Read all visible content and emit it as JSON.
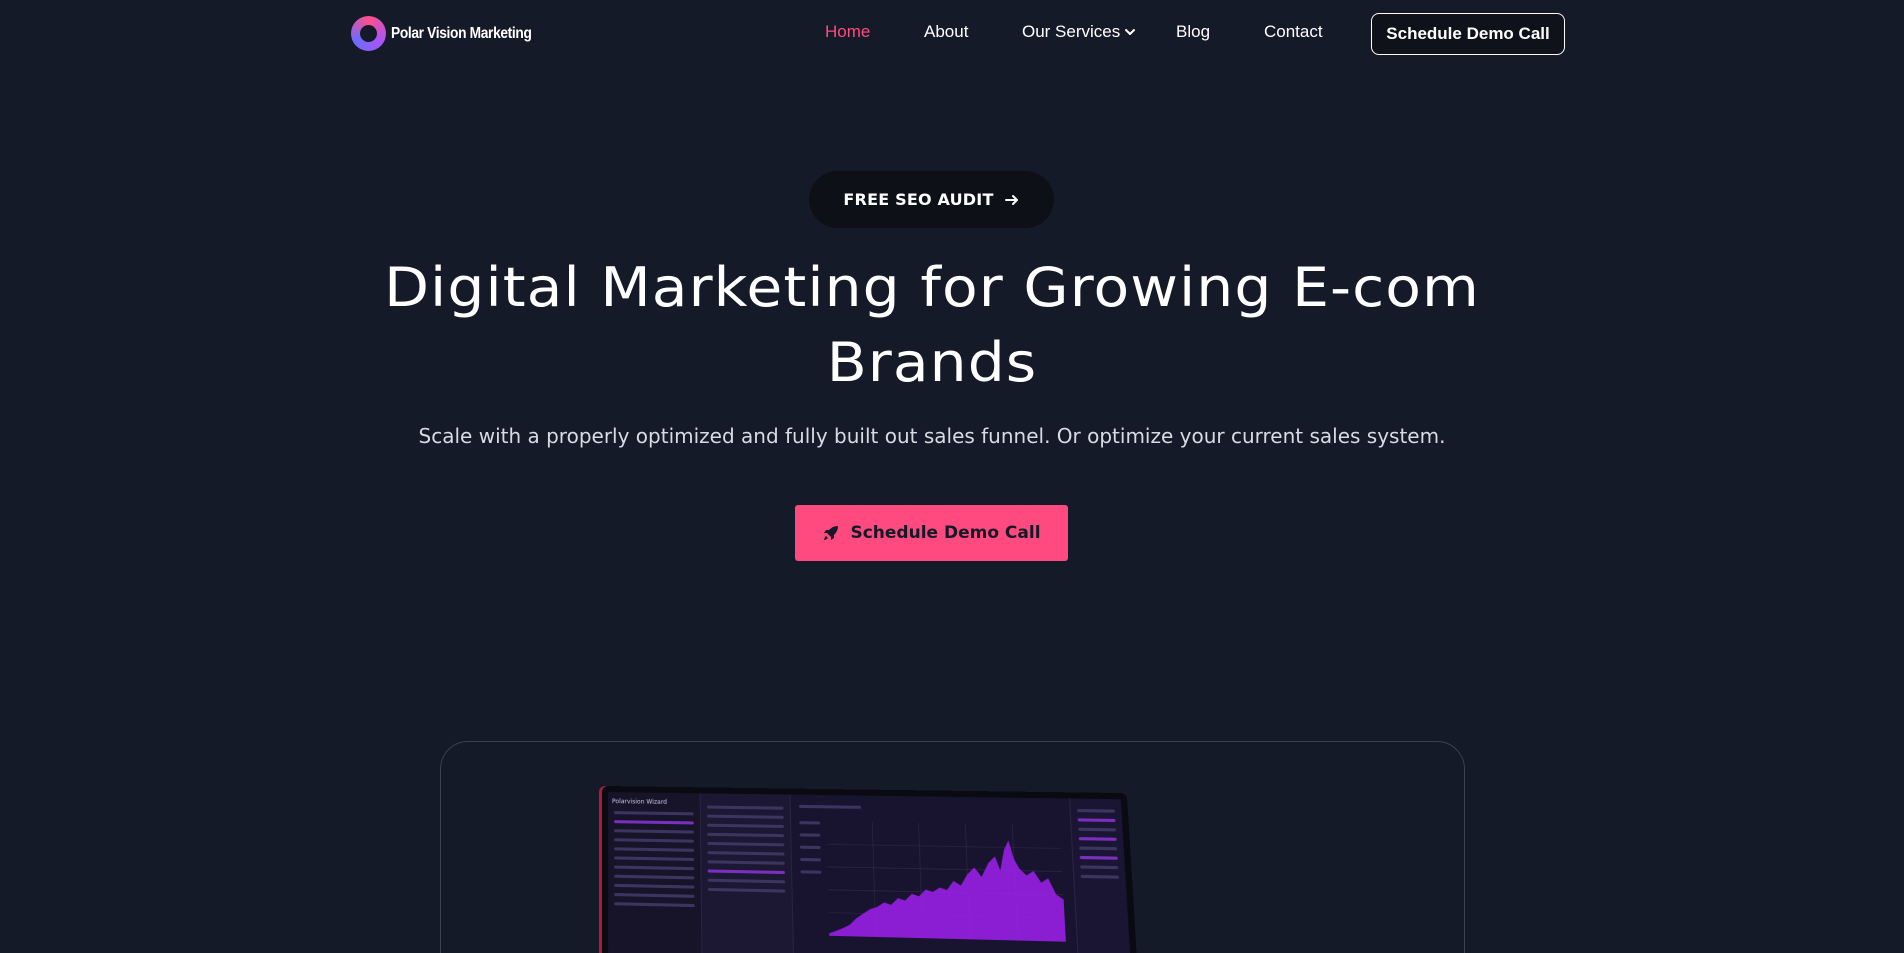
{
  "brand": {
    "name": "Polar Vision Marketing"
  },
  "nav": {
    "links": [
      {
        "label": "Home",
        "active": true
      },
      {
        "label": "About",
        "active": false
      },
      {
        "label": "Our Services",
        "active": false,
        "has_dropdown": true
      },
      {
        "label": "Blog",
        "active": false
      },
      {
        "label": "Contact",
        "active": false
      }
    ],
    "cta_label": "Schedule Demo Call"
  },
  "hero": {
    "pill_label": "FREE SEO AUDIT",
    "title_line1": "Digital Marketing for Growing E-com",
    "title_line2": "Brands",
    "subtitle": "Scale with a properly optimized and fully built out sales funnel. Or optimize your current sales system.",
    "cta_label": "Schedule Demo Call"
  },
  "preview": {
    "screen_title": "Polarvision Wizard"
  },
  "colors": {
    "background": "#151a28",
    "accent": "#ff4a7f",
    "active_nav": "#ff4b7d",
    "chart_fill": "#a020f0"
  },
  "icons": {
    "logo": "ring-logo-icon",
    "dropdown": "chevron-down-icon",
    "pill_arrow": "arrow-right-icon",
    "cta": "rocket-icon"
  }
}
